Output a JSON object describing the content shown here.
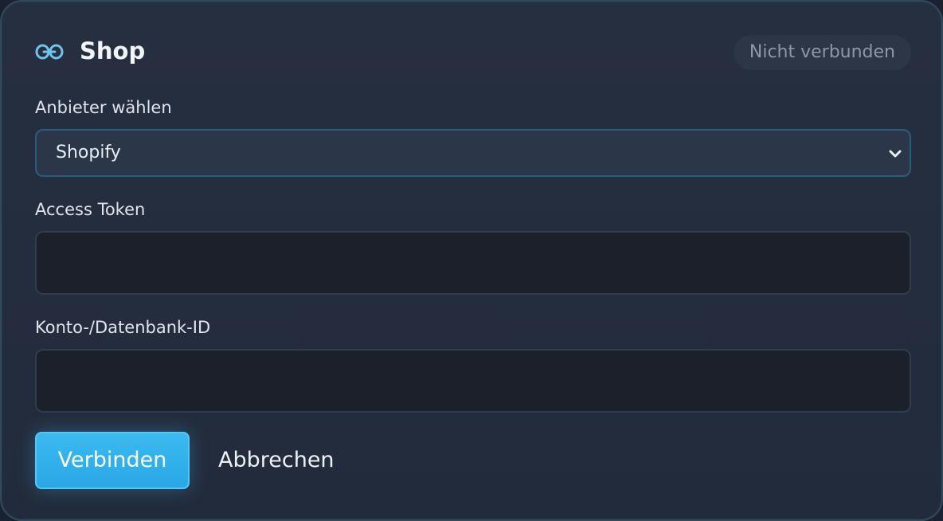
{
  "card": {
    "title": "Shop",
    "status_badge": "Nicht verbunden",
    "icon": "link-icon"
  },
  "provider": {
    "label": "Anbieter wählen",
    "selected": "Shopify",
    "icon": "chevron-down-icon"
  },
  "access_token": {
    "label": "Access Token",
    "value": ""
  },
  "account_id": {
    "label": "Konto-/Datenbank-ID",
    "value": ""
  },
  "actions": {
    "connect_label": "Verbinden",
    "cancel_label": "Abbrechen"
  },
  "colors": {
    "accent": "#38b2f0",
    "card_bg": "#252e3f",
    "input_bg": "#1b202b"
  }
}
